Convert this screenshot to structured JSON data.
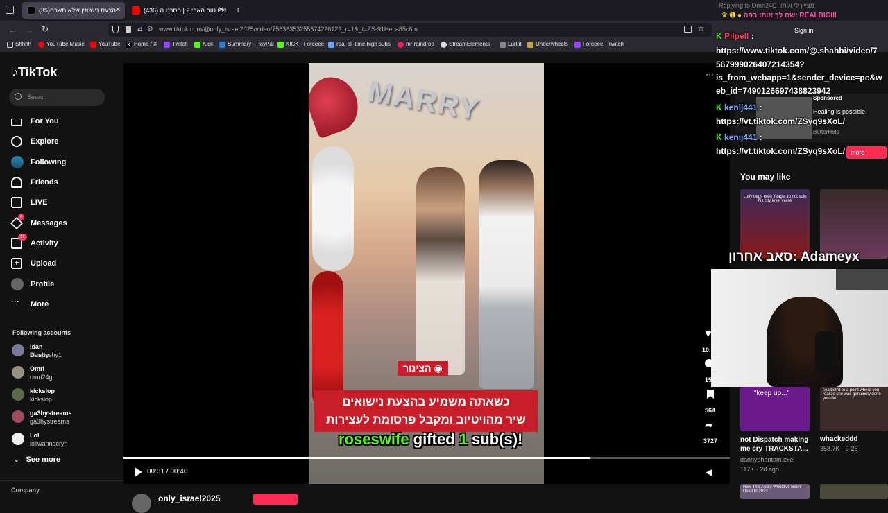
{
  "browser": {
    "tabs": [
      {
        "label": "(35)הצעת נישואין שלא תשכח",
        "active": true,
        "icon": "tiktok-icon"
      },
      {
        "label": "(436) שם טוב האבי 2 | הסרט ה",
        "active": false,
        "icon": "youtube-icon"
      }
    ],
    "url": "www.tiktok.com/@only_israel2025/video/7563635325537422612?_r=1&_t=ZS-91Heca85c8m",
    "bookmarks": [
      "Shhhh",
      "YouTube Music",
      "YouTube",
      "Home / X",
      "Twitch",
      "Kick",
      "Summary - PayPal",
      "KICK - Forceee",
      "real all-time high subs",
      "mr raindrop",
      "StreamElements -",
      "Lurkit",
      "Underwheels",
      "Forceee - Twitch"
    ]
  },
  "sidebar": {
    "logo": "TikTok",
    "search_placeholder": "Search",
    "nav": [
      {
        "label": "For You",
        "icon": "home-icon"
      },
      {
        "label": "Explore",
        "icon": "compass-icon"
      },
      {
        "label": "Following",
        "icon": "following-avatar-icon"
      },
      {
        "label": "Friends",
        "icon": "friends-icon"
      },
      {
        "label": "LIVE",
        "icon": "live-icon"
      },
      {
        "label": "Messages",
        "icon": "send-icon",
        "badge": "4"
      },
      {
        "label": "Activity",
        "icon": "inbox-icon",
        "badge": "31"
      },
      {
        "label": "Upload",
        "icon": "upload-icon"
      },
      {
        "label": "Profile",
        "icon": "profile-avatar-icon"
      },
      {
        "label": "More",
        "icon": "more-icon"
      }
    ],
    "following_title": "Following accounts",
    "following": [
      {
        "name": "Idan Dushy",
        "handle": "idandushy1"
      },
      {
        "name": "Omri",
        "handle": "omri24g"
      },
      {
        "name": "kickslop",
        "handle": "kickslop"
      },
      {
        "name": "ga3hystreams",
        "handle": "ga3hystreams"
      },
      {
        "name": "Lol",
        "handle": "loliwannacryn"
      }
    ],
    "see_more": "See more",
    "company": "Company"
  },
  "video": {
    "balloon_text": "MARRY",
    "caption_badge": "הצינור",
    "caption_line1": "כשאתה משמיע בהצעת נישואים",
    "caption_line2": "שיר מהויטיוב ומקבל פרסומת לעצירות",
    "gift_user": "roseswife",
    "gift_word": "gifted",
    "gift_count": "1",
    "gift_unit": "sub(s)!",
    "time": "00:31 / 00:40",
    "progress": 0.77,
    "author": "only_israel2025"
  },
  "actions": {
    "likes": "10.",
    "comments": "15",
    "saves": "564",
    "shares": "3727"
  },
  "right_panel": {
    "you_may_like": "You may like",
    "sponsored": "Sponsored",
    "ad_title": "Healing is possible.",
    "ad_sub": "BetterHelp",
    "cards": [
      {
        "thumb_text": "Luffy begs eren Yeager to not solo his city level verse"
      },
      {
        "thumb_text": "\"keep up...\"",
        "title": "not Dispatch making me cry TRACKSTA...",
        "author": "dannyphantom.exe",
        "stats": "117K · 2d ago"
      },
      {
        "thumb_text": "seatbelt'd to a point where you realize she was genuinely done you dirt",
        "title": "whackeddd",
        "stats": "358.7K · 9-26"
      },
      {
        "thumb_text": "How This Audio Would've Been Used In 2023"
      }
    ]
  },
  "overlay": {
    "reply_header": "Replying to Omri24G: מצייץ לי אותו",
    "chat_top": "שם לך אותו בפה: REALBIGIII",
    "chat": [
      {
        "user": "Pilpell",
        "color": "#ff3b5c",
        "text": "https://www.tiktok.com/@.shahbi/video/7"
      },
      {
        "user": "",
        "color": "#fff",
        "text": "567999026407214354?"
      },
      {
        "user": "",
        "color": "#fff",
        "text": "is_from_webapp=1&sender_device=pc&w"
      },
      {
        "user": "",
        "color": "#fff",
        "text": "eb_id=7490126697438823942"
      },
      {
        "user": "kenij441",
        "color": "#7fa8ff",
        "text": "https://vt.tiktok.com/ZSyq9sXoL/"
      },
      {
        "user": "kenij441",
        "color": "#7fa8ff",
        "text": "https://vt.tiktok.com/ZSyq9sXoL/"
      }
    ],
    "sign_in": "Sign in",
    "more_pill": "more",
    "last_follow": "סאב אחרון: Adameyx"
  }
}
